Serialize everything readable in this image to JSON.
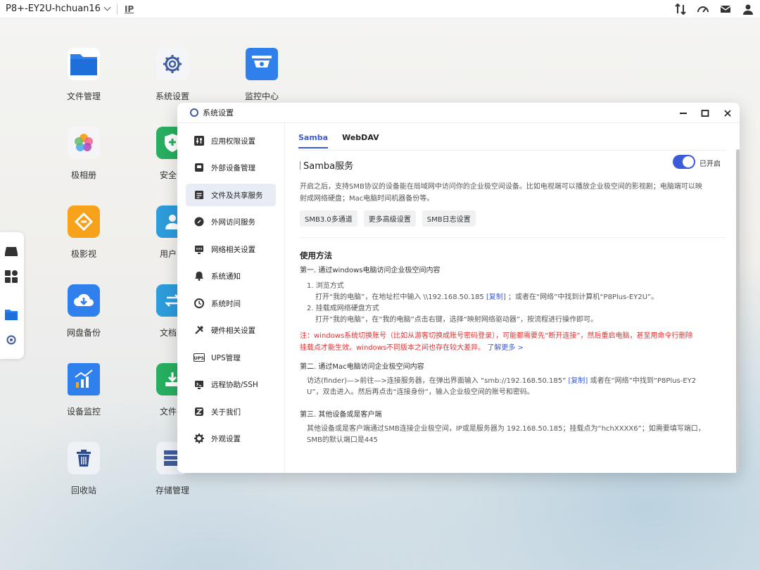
{
  "topbar": {
    "device_name": "P8+-EY2U-hchuan16",
    "ip_label": "IP",
    "icons": [
      "transfer-icon",
      "speed-icon",
      "mail-icon",
      "user-icon"
    ]
  },
  "desktop": [
    {
      "label": "文件管理",
      "icon": "folder-icon",
      "color": "#2f80ed"
    },
    {
      "label": "系统设置",
      "icon": "gear-icon",
      "color": "#ffffff"
    },
    {
      "label": "监控中心",
      "icon": "camera-icon",
      "color": "#2f80ed"
    },
    {
      "label": "极相册",
      "icon": "photos-icon",
      "color": "#ffffff"
    },
    {
      "label": "安全管",
      "icon": "shield-icon",
      "color": "#27ae60"
    },
    {
      "label": "极影视",
      "icon": "film-icon",
      "color": "#f7a21b"
    },
    {
      "label": "用户中",
      "icon": "user-icon",
      "color": "#2d9cdb"
    },
    {
      "label": "网盘备份",
      "icon": "cloud-download-icon",
      "color": "#2f80ed"
    },
    {
      "label": "文档同",
      "icon": "sync-icon",
      "color": "#2d9cdb"
    },
    {
      "label": "设备监控",
      "icon": "chart-icon",
      "color": "#2f80ed"
    },
    {
      "label": "文件收",
      "icon": "inbox-icon",
      "color": "#27ae60"
    },
    {
      "label": "回收站",
      "icon": "trash-icon",
      "color": "#eef1f6"
    },
    {
      "label": "存储管理",
      "icon": "storage-icon",
      "color": "#eef1f6"
    }
  ],
  "dock": [
    "drive-icon",
    "apps-icon",
    "folder-icon",
    "gear-icon"
  ],
  "window": {
    "title": "系统设置",
    "sidebar": [
      {
        "label": "应用权限设置",
        "icon": "sliders-icon"
      },
      {
        "label": "外部设备管理",
        "icon": "usb-icon"
      },
      {
        "label": "文件及共享服务",
        "icon": "file-share-icon"
      },
      {
        "label": "外网访问服务",
        "icon": "link-icon"
      },
      {
        "label": "网络相关设置",
        "icon": "network-icon"
      },
      {
        "label": "系统通知",
        "icon": "bell-icon"
      },
      {
        "label": "系统时间",
        "icon": "clock-icon"
      },
      {
        "label": "硬件相关设置",
        "icon": "tools-icon"
      },
      {
        "label": "UPS管理",
        "icon": "ups-icon"
      },
      {
        "label": "远程协助/SSH",
        "icon": "terminal-icon"
      },
      {
        "label": "关于我们",
        "icon": "about-icon"
      },
      {
        "label": "外观设置",
        "icon": "gear-icon"
      }
    ],
    "active_index": 2,
    "tabs": [
      "Samba",
      "WebDAV"
    ],
    "service_title": "Samba服务",
    "toggle_label": "已开启",
    "toggle_on": true,
    "desc_line1": "开启之后，支持SMB协议的设备能在局域网中访问你的企业极空间设备。比如电视端可以播放企业极空间的影视剧；电脑端可以映",
    "desc_line2": "射成网络硬盘；Mac电脑时间机器备份等。",
    "buttons": [
      "SMB3.0多通道",
      "更多高级设置",
      "SMB日志设置"
    ],
    "usage_title": "使用方法",
    "win_title": "第一. 通过windows电脑访问企业极空间内容",
    "win_step1_title": "1. 浏览方式",
    "win_step1_a": "打开“我的电脑”，在地址栏中输入 \\\\192.168.50.185",
    "copy": "[复制]",
    "win_step1_b": "；或者在“网络”中找到计算机“P8Plus-EY2U”。",
    "win_step2_title": "2. 挂载成网络硬盘方式",
    "win_step2_body": "打开“我的电脑”，在“我的电脑”点击右键，选择“映射网络驱动器”，按流程进行操作即可。",
    "note_line1": "注：windows系统切换账号（比如从游客切换成账号密码登录），可能都需要先“断开连接”，然后重启电脑，甚至用命令行删除",
    "note_line2": "挂载点才能生效。windows不同版本之间也存在较大差异。",
    "learn_more": "了解更多 >",
    "mac_title": "第二. 通过Mac电脑访问企业极空间内容",
    "mac_line1_a": "访达(finder)—>前往—>连接服务器，在弹出界面输入 “smb://192.168.50.185”",
    "mac_line1_b": "或者在“网络”中找到“P8Plus-EY2",
    "mac_line2": "U”，双击进入。然后再点击“连接身份”，输入企业极空间的账号和密码。",
    "other_title": "第三. 其他设备或是客户端",
    "other_line1": "其他设备或是客户端通过SMB连接企业极空间，IP或是服务器为 192.168.50.185；挂载点为“hchXXXX6”；如需要填写端口，",
    "other_line2": "SMB的默认端口是445"
  }
}
